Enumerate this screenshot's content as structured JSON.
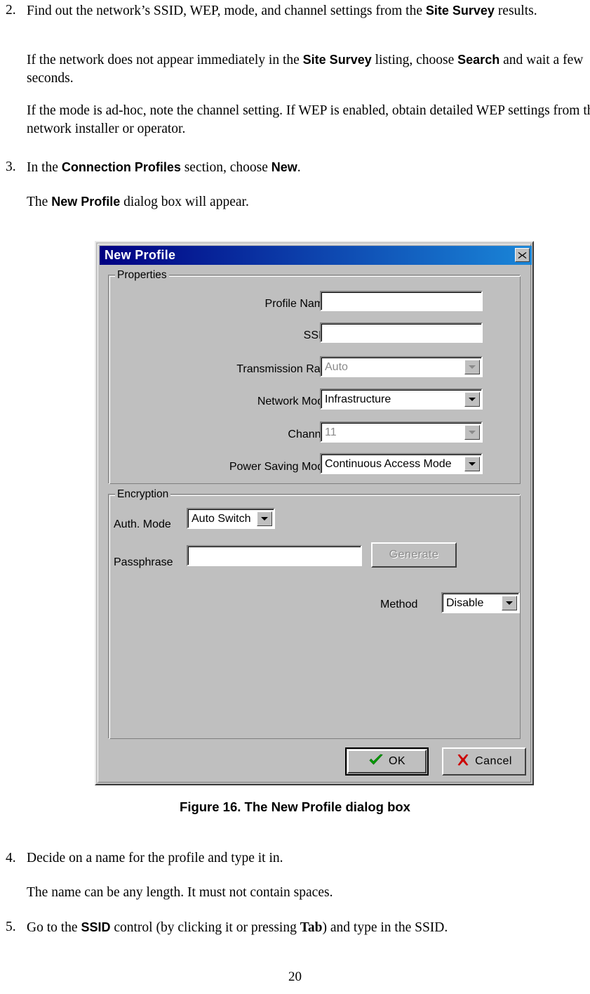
{
  "document": {
    "steps": [
      {
        "number": "2.",
        "segments": [
          {
            "text": "Find out the network’s SSID, WEP, mode, and channel settings from the ",
            "style": "normal"
          },
          {
            "text": "Site Survey",
            "style": "ui-bold"
          },
          {
            "text": " results.",
            "style": "normal"
          }
        ],
        "full_text": "Find out the network’s SSID, WEP, mode, and channel settings from the Site Survey results."
      },
      {
        "number": "3.",
        "segments": [
          {
            "text": "In the ",
            "style": "normal"
          },
          {
            "text": "Connection Profiles",
            "style": "ui-bold"
          },
          {
            "text": " section, choose ",
            "style": "normal"
          },
          {
            "text": "New",
            "style": "ui-bold"
          },
          {
            "text": ".",
            "style": "normal"
          }
        ],
        "full_text": "In the Connection Profiles section, choose New."
      },
      {
        "number": "4.",
        "segments": [
          {
            "text": "Decide on a name for the profile and type it in.",
            "style": "normal"
          }
        ],
        "full_text": "Decide on a name for the profile and type it in."
      },
      {
        "number": "5.",
        "segments": [
          {
            "text": "Go to the ",
            "style": "normal"
          },
          {
            "text": "SSID",
            "style": "ui-bold"
          },
          {
            "text": " control (by clicking it or pressing ",
            "style": "normal"
          },
          {
            "text": "Tab",
            "style": "serif-bold"
          },
          {
            "text": ") and type in the SSID.",
            "style": "normal"
          }
        ],
        "full_text": "Go to the SSID control (by clicking it or pressing Tab) and type in the SSID."
      }
    ],
    "body_paragraphs": {
      "site_survey_note": "If the network does not appear immediately in the Site Survey listing, choose Search and wait a few seconds.",
      "adhoc_note": "If the mode is ad-hoc, note the channel setting. If WEP is enabled, obtain detailed WEP settings from the network installer or operator.",
      "dialog_appear": "The New Profile dialog box will appear.",
      "name_length_note": "The name can be any length. It must not contain spaces."
    },
    "figure_caption": "Figure 16.  The New Profile dialog box",
    "page_number": "20"
  },
  "dialog": {
    "title": "New Profile",
    "close_icon": "✕",
    "properties": {
      "group_title": "Properties",
      "fields": [
        {
          "label": "Profile Name",
          "control": "textbox",
          "value": "",
          "disabled": false
        },
        {
          "label": "SSID",
          "control": "textbox",
          "value": "",
          "disabled": false
        },
        {
          "label": "Transmission Rate",
          "control": "combo",
          "value": "Auto",
          "disabled": true
        },
        {
          "label": "Network Mode",
          "control": "combo",
          "value": "Infrastructure",
          "disabled": false
        },
        {
          "label": "Channel",
          "control": "combo",
          "value": "11",
          "disabled": true
        },
        {
          "label": "Power Saving Mode",
          "control": "combo",
          "value": "Continuous Access Mode",
          "disabled": false
        }
      ]
    },
    "encryption": {
      "group_title": "Encryption",
      "auth_mode_label": "Auth. Mode",
      "auth_mode_value": "Auto Switch",
      "passphrase_label": "Passphrase",
      "passphrase_value": "",
      "generate_label": "Generate",
      "method_label": "Method",
      "method_value": "Disable"
    },
    "buttons": {
      "ok_label": "OK",
      "cancel_label": "Cancel"
    },
    "colors": {
      "titlebar_start": "#000082",
      "titlebar_end": "#1a86d8",
      "face": "#bfbfbf",
      "ok_check": "#00a000",
      "cancel_x": "#cc0000"
    }
  }
}
